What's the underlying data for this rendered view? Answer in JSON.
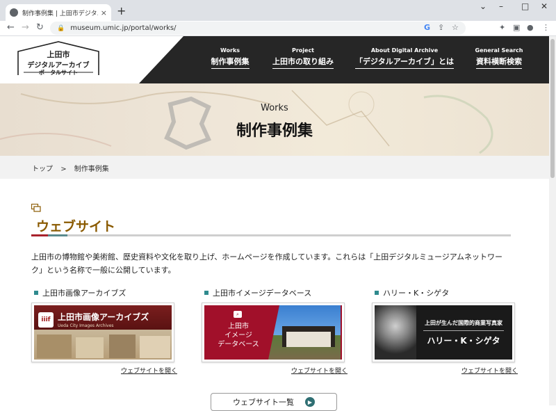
{
  "browser": {
    "tab_title": "制作事例集 | 上田市デジタルアーカ",
    "tab_close": "×",
    "new_tab": "+",
    "url": "museum.umic.jp/portal/works/",
    "win_min": "–",
    "win_max": "□",
    "win_close": "✕",
    "back": "←",
    "forward": "→",
    "reload": "↻"
  },
  "logo": {
    "line1": "上田市",
    "line2": "デジタルアーカイブ",
    "line3": "ポータルサイト"
  },
  "nav": [
    {
      "en": "Works",
      "ja": "制作事例集"
    },
    {
      "en": "Project",
      "ja": "上田市の取り組み"
    },
    {
      "en": "About Digital Archive",
      "ja": "「デジタルアーカイブ」とは"
    },
    {
      "en": "General Search",
      "ja": "資料横断検索"
    }
  ],
  "hero": {
    "en": "Works",
    "ja": "制作事例集"
  },
  "breadcrumb": {
    "home": "トップ",
    "sep": ">",
    "current": "制作事例集"
  },
  "section": {
    "title": "ウェブサイト",
    "description": "上田市の博物館や美術館、歴史資料や文化を取り上げ、ホームページを作成しています。これらは「上田デジタルミュージアムネットワーク」という名称で一般に公開しています。"
  },
  "cards": [
    {
      "title": "上田市画像アーカイブズ",
      "banner": "上田市画像アーカイブズ",
      "banner_sub": "Ueda City Images Archives",
      "open": "ウェブサイトを開く"
    },
    {
      "title": "上田市イメージデータベース",
      "banner": "上田市\nイメージ\nデータベース",
      "open": "ウェブサイトを開く"
    },
    {
      "title": "ハリー・K・シゲタ",
      "banner": "上田が生んだ国際的商業写真家",
      "banner_sub": "ハリー・K・シゲタ",
      "open": "ウェブサイトを開く"
    }
  ],
  "more_button": "ウェブサイト一覧"
}
